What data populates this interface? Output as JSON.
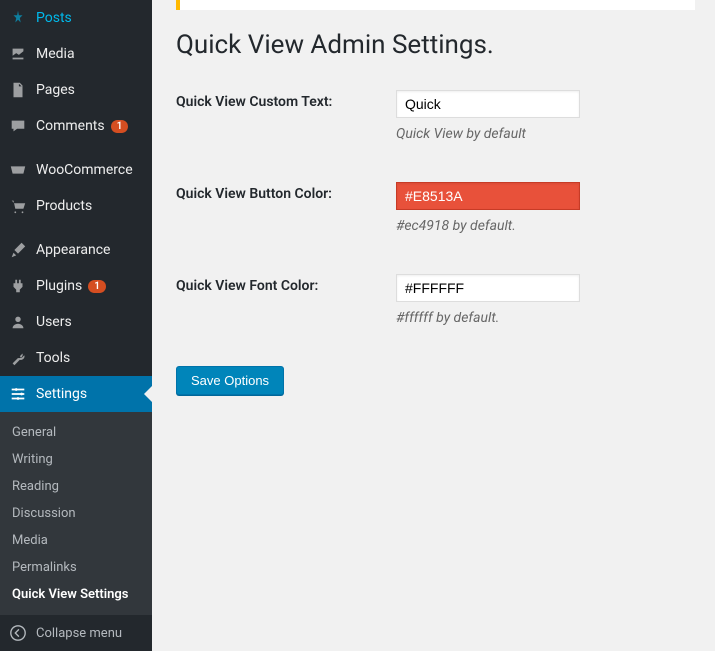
{
  "sidebar": {
    "items": [
      {
        "label": "Posts",
        "icon": "pin"
      },
      {
        "label": "Media",
        "icon": "media"
      },
      {
        "label": "Pages",
        "icon": "page"
      },
      {
        "label": "Comments",
        "icon": "comment",
        "badge": "1"
      },
      {
        "label": "WooCommerce",
        "icon": "woo"
      },
      {
        "label": "Products",
        "icon": "cart"
      },
      {
        "label": "Appearance",
        "icon": "brush"
      },
      {
        "label": "Plugins",
        "icon": "plug",
        "badge": "1"
      },
      {
        "label": "Users",
        "icon": "user"
      },
      {
        "label": "Tools",
        "icon": "wrench"
      },
      {
        "label": "Settings",
        "icon": "sliders",
        "active": true
      }
    ],
    "submenu": [
      {
        "label": "General"
      },
      {
        "label": "Writing"
      },
      {
        "label": "Reading"
      },
      {
        "label": "Discussion"
      },
      {
        "label": "Media"
      },
      {
        "label": "Permalinks"
      },
      {
        "label": "Quick View Settings",
        "active": true
      }
    ],
    "collapse": "Collapse menu"
  },
  "page": {
    "title": "Quick View Admin Settings.",
    "fields": {
      "customText": {
        "label": "Quick View Custom Text:",
        "value": "Quick",
        "desc": "Quick View by default"
      },
      "buttonColor": {
        "label": "Quick View Button Color:",
        "value": "#E8513A",
        "desc": "#ec4918 by default."
      },
      "fontColor": {
        "label": "Quick View Font Color:",
        "value": "#FFFFFF",
        "desc": "#ffffff by default."
      }
    },
    "saveButton": "Save Options"
  }
}
